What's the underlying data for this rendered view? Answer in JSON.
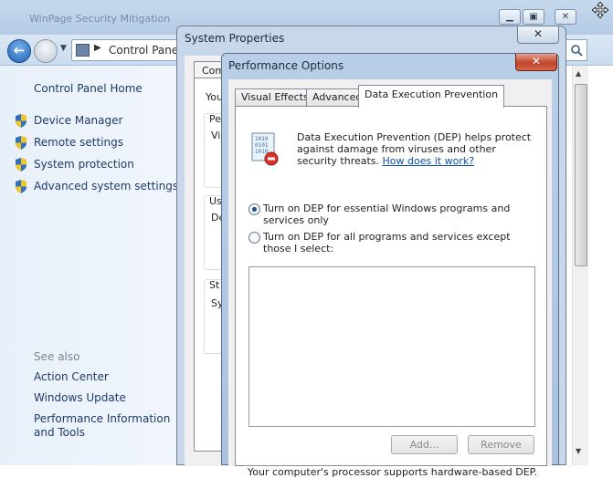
{
  "control_panel": {
    "title": "WinPage Security Mitigation",
    "caption": {
      "minimize": "▁",
      "maximize": "▣",
      "close": "✕"
    },
    "address": "Control Panel",
    "sidebar": {
      "home": "Control Panel Home",
      "tasks": [
        {
          "label": "Device Manager"
        },
        {
          "label": "Remote settings"
        },
        {
          "label": "System protection"
        },
        {
          "label": "Advanced system settings"
        }
      ],
      "see_also_heading": "See also",
      "see_also": [
        {
          "label": "Action Center"
        },
        {
          "label": "Windows Update"
        },
        {
          "label": "Performance Information and Tools"
        }
      ]
    }
  },
  "system_properties": {
    "title": "System Properties",
    "close": "✕",
    "tab_fragment": "Comp",
    "fragments": [
      "You",
      "Pe",
      "Vis",
      "Us",
      "De",
      "St",
      "Sy"
    ]
  },
  "performance_options": {
    "title": "Performance Options",
    "close": "✕",
    "tabs": [
      {
        "label": "Visual Effects"
      },
      {
        "label": "Advanced"
      },
      {
        "label": "Data Execution Prevention"
      }
    ],
    "description": "Data Execution Prevention (DEP) helps protect against damage from viruses and other security threats.",
    "link": "How does it work?",
    "options": [
      {
        "label": "Turn on DEP for essential Windows programs and services only",
        "selected": true
      },
      {
        "label": "Turn on DEP for all programs and services except those I select:",
        "selected": false
      }
    ],
    "add_button": "Add...",
    "remove_button": "Remove",
    "hardware_note": "Your computer's processor supports hardware-based DEP."
  }
}
